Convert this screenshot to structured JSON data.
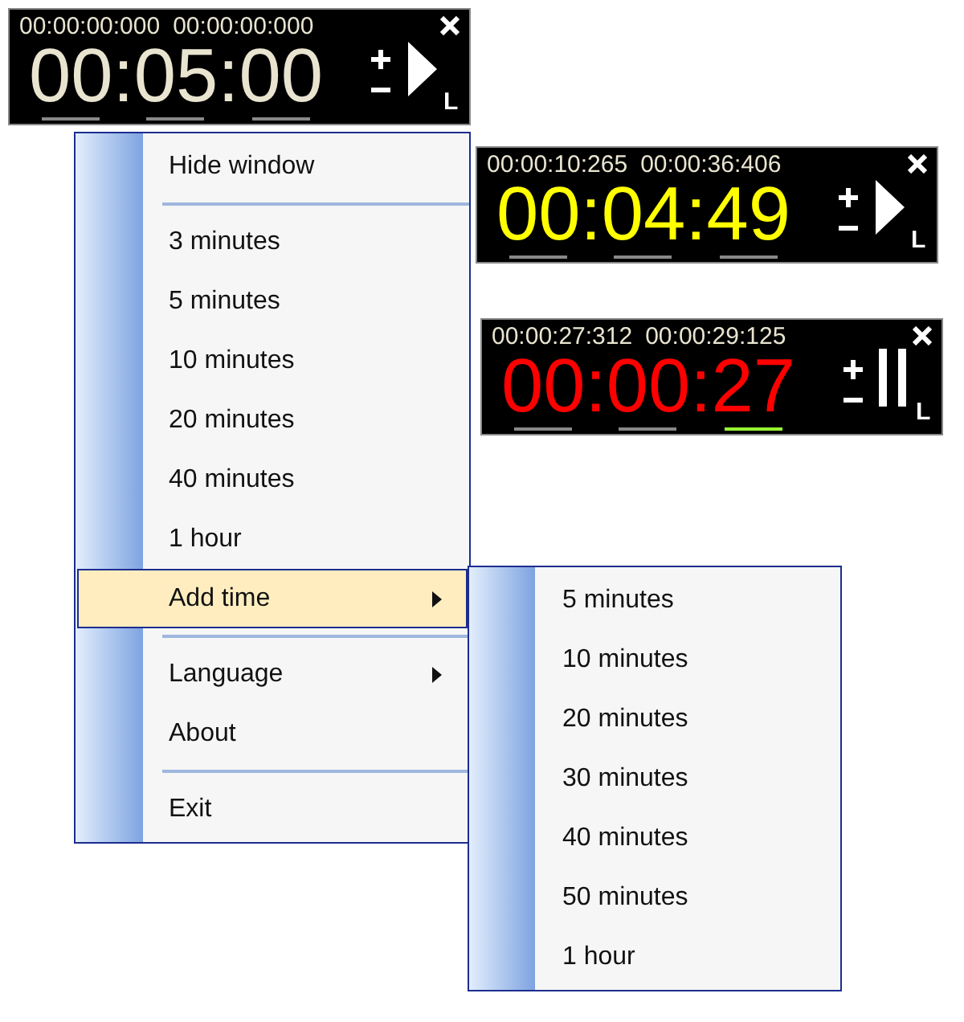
{
  "timers": [
    {
      "elapsed": "00:00:00:000",
      "total": "00:00:00:000",
      "separator": ":",
      "segments": [
        {
          "text": "00",
          "selected": false
        },
        {
          "text": "05",
          "selected": false
        },
        {
          "text": "00",
          "selected": false
        }
      ],
      "color": "#e8e4d0",
      "running": false,
      "corner_label": "L"
    },
    {
      "elapsed": "00:00:10:265",
      "total": "00:00:36:406",
      "separator": ":",
      "segments": [
        {
          "text": "00",
          "selected": false
        },
        {
          "text": "04",
          "selected": false
        },
        {
          "text": "49",
          "selected": false
        }
      ],
      "color": "#ffff00",
      "running": false,
      "corner_label": "L"
    },
    {
      "elapsed": "00:00:27:312",
      "total": "00:00:29:125",
      "separator": ":",
      "segments": [
        {
          "text": "00",
          "selected": false
        },
        {
          "text": "00",
          "selected": false
        },
        {
          "text": "27",
          "selected": true
        }
      ],
      "color": "#ff0000",
      "running": true,
      "corner_label": "L"
    }
  ],
  "context_menu": {
    "items": [
      {
        "kind": "item",
        "label": "Hide window",
        "selected": false,
        "has_submenu": false
      },
      {
        "kind": "separator"
      },
      {
        "kind": "item",
        "label": "3 minutes",
        "selected": false,
        "has_submenu": false
      },
      {
        "kind": "item",
        "label": "5 minutes",
        "selected": false,
        "has_submenu": false
      },
      {
        "kind": "item",
        "label": "10 minutes",
        "selected": false,
        "has_submenu": false
      },
      {
        "kind": "item",
        "label": "20 minutes",
        "selected": false,
        "has_submenu": false
      },
      {
        "kind": "item",
        "label": "40 minutes",
        "selected": false,
        "has_submenu": false
      },
      {
        "kind": "item",
        "label": "1 hour",
        "selected": false,
        "has_submenu": false
      },
      {
        "kind": "item",
        "label": "Add time",
        "selected": true,
        "has_submenu": true
      },
      {
        "kind": "separator"
      },
      {
        "kind": "item",
        "label": "Language",
        "selected": false,
        "has_submenu": true
      },
      {
        "kind": "item",
        "label": "About",
        "selected": false,
        "has_submenu": false
      },
      {
        "kind": "separator"
      },
      {
        "kind": "item",
        "label": "Exit",
        "selected": false,
        "has_submenu": false
      }
    ]
  },
  "submenu": {
    "items": [
      {
        "kind": "item",
        "label": "5 minutes",
        "selected": false,
        "has_submenu": false
      },
      {
        "kind": "item",
        "label": "10 minutes",
        "selected": false,
        "has_submenu": false
      },
      {
        "kind": "item",
        "label": "20 minutes",
        "selected": false,
        "has_submenu": false
      },
      {
        "kind": "item",
        "label": "30 minutes",
        "selected": false,
        "has_submenu": false
      },
      {
        "kind": "item",
        "label": "40 minutes",
        "selected": false,
        "has_submenu": false
      },
      {
        "kind": "item",
        "label": "50 minutes",
        "selected": false,
        "has_submenu": false
      },
      {
        "kind": "item",
        "label": "1 hour",
        "selected": false,
        "has_submenu": false
      }
    ]
  }
}
